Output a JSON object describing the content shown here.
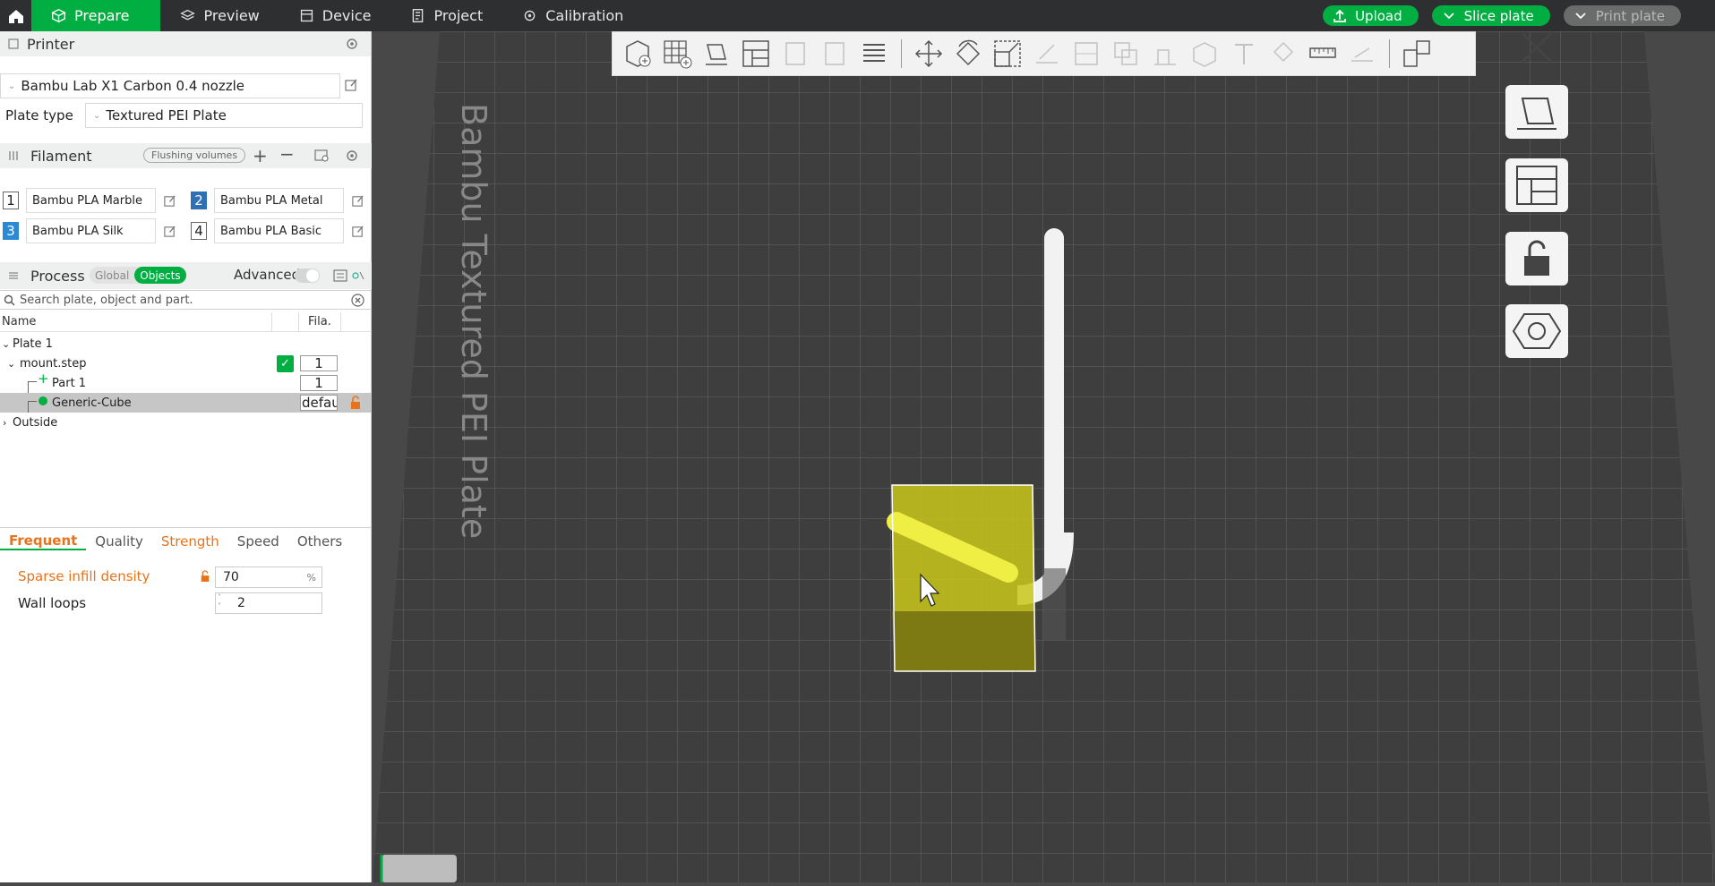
{
  "topbar": {
    "tabs": [
      "Prepare",
      "Preview",
      "Device",
      "Project",
      "Calibration"
    ],
    "upload": "Upload",
    "slice": "Slice plate",
    "print": "Print plate"
  },
  "printer": {
    "header": "Printer",
    "name": "Bambu Lab X1 Carbon 0.4 nozzle",
    "plate_type_label": "Plate type",
    "plate_type": "Textured PEI Plate"
  },
  "filament": {
    "header": "Filament",
    "flushing": "Flushing volumes",
    "items": [
      {
        "num": "1",
        "name": "Bambu PLA Marble"
      },
      {
        "num": "2",
        "name": "Bambu PLA Metal"
      },
      {
        "num": "3",
        "name": "Bambu PLA Silk"
      },
      {
        "num": "4",
        "name": "Bambu PLA Basic"
      }
    ]
  },
  "process": {
    "header": "Process",
    "global": "Global",
    "objects": "Objects",
    "advanced": "Advanced",
    "search_placeholder": "Search plate, object and part."
  },
  "tree": {
    "col_name": "Name",
    "col_fila": "Fila.",
    "plate": "Plate 1",
    "object": "mount.step",
    "object_fila": "1",
    "part": "Part 1",
    "part_fila": "1",
    "cube": "Generic-Cube",
    "cube_fila": "defau",
    "outside": "Outside"
  },
  "settings": {
    "tabs": [
      "Frequent",
      "Quality",
      "Strength",
      "Speed",
      "Others"
    ],
    "sparse_label": "Sparse infill density",
    "sparse_value": "70",
    "sparse_unit": "%",
    "wall_label": "Wall loops",
    "wall_value": "2"
  },
  "plate_label": "Bambu Textured PEI Plate",
  "colors": {
    "accent": "#00ae42",
    "highlight": "#e8731a",
    "selection": "#d8d420"
  }
}
